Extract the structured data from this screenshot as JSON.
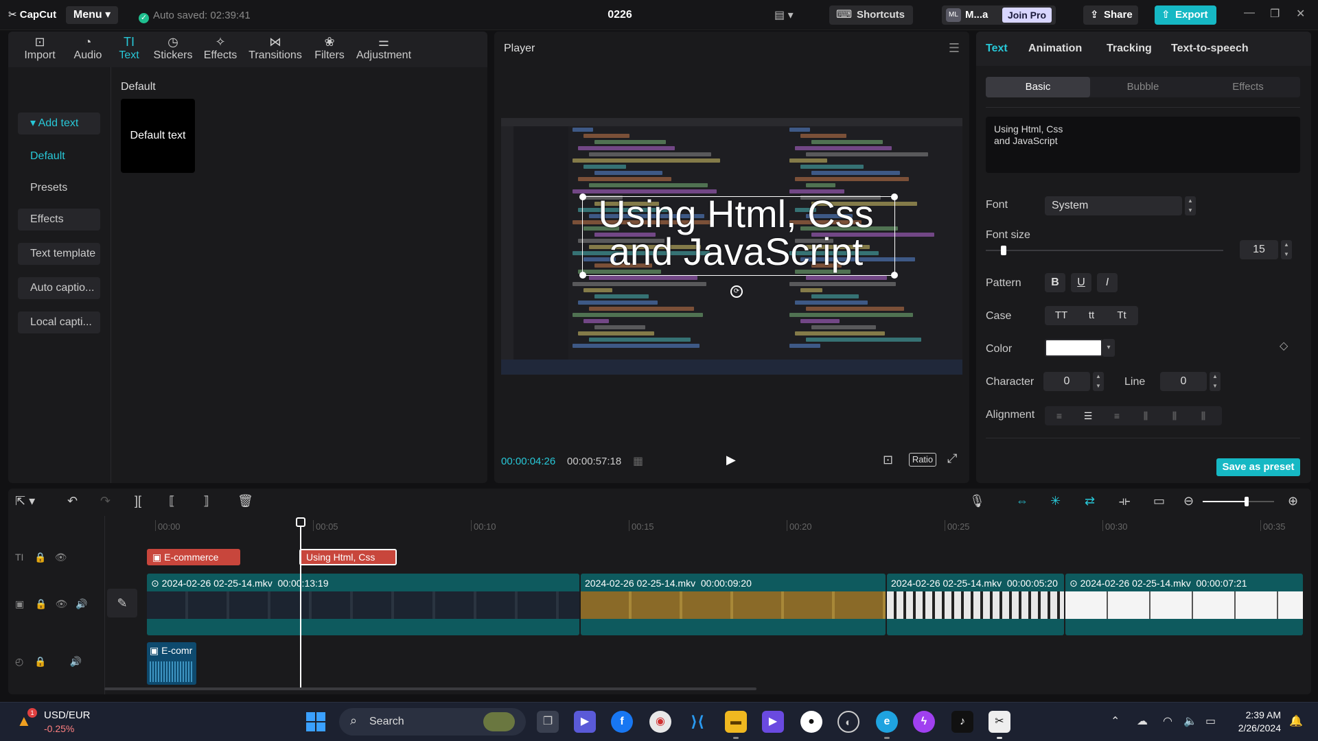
{
  "titlebar": {
    "logo": "CapCut",
    "menu_label": "Menu",
    "autosave": "Auto saved: 02:39:41",
    "project_title": "0226",
    "shortcuts_label": "Shortcuts",
    "avatar_initials": "ML",
    "username": "M...a",
    "join_pro_label": "Join Pro",
    "share_label": "Share",
    "export_label": "Export"
  },
  "toolbar": {
    "tabs": [
      {
        "label": "Import",
        "icon": "import-icon"
      },
      {
        "label": "Audio",
        "icon": "audio-icon"
      },
      {
        "label": "Text",
        "icon": "text-icon",
        "active": true
      },
      {
        "label": "Stickers",
        "icon": "stickers-icon"
      },
      {
        "label": "Effects",
        "icon": "effects-icon"
      },
      {
        "label": "Transitions",
        "icon": "transitions-icon"
      },
      {
        "label": "Filters",
        "icon": "filters-icon"
      },
      {
        "label": "Adjustment",
        "icon": "adjustment-icon"
      }
    ]
  },
  "text_panel": {
    "nav": [
      "Add text",
      "Default",
      "Presets",
      "Effects",
      "Text template",
      "Auto captio...",
      "Local capti..."
    ],
    "section_title": "Default",
    "card_label": "Default text"
  },
  "player": {
    "title": "Player",
    "overlay_line1": "Using Html, Css",
    "overlay_line2": "and JavaScript",
    "current_time": "00:00:04:26",
    "total_time": "00:00:57:18",
    "ratio_label": "Ratio"
  },
  "properties": {
    "tabs": [
      "Text",
      "Animation",
      "Tracking",
      "Text-to-speech"
    ],
    "segments": [
      "Basic",
      "Bubble",
      "Effects"
    ],
    "text_value": "Using Html, Css\nand JavaScript",
    "font_label": "Font",
    "font_value": "System",
    "font_size_label": "Font size",
    "font_size_value": "15",
    "font_size_fraction": 0.04,
    "pattern_label": "Pattern",
    "pattern_buttons": [
      "B",
      "U",
      "I"
    ],
    "case_label": "Case",
    "case_buttons": [
      "TT",
      "tt",
      "Tt"
    ],
    "color_label": "Color",
    "color_value": "#ffffff",
    "character_label": "Character",
    "character_value": "0",
    "line_label": "Line",
    "line_value": "0",
    "alignment_label": "Alignment",
    "save_preset_label": "Save as preset"
  },
  "timeline": {
    "ruler": [
      "00:00",
      "00:05",
      "00:10",
      "00:15",
      "00:20",
      "00:25",
      "00:30",
      "00:35"
    ],
    "text_clips": [
      "E-commerce",
      "Using Html, Css"
    ],
    "video_clips": [
      {
        "label": "2024-02-26 02-25-14.mkv",
        "duration": "00:00:13:19"
      },
      {
        "label": "2024-02-26 02-25-14.mkv",
        "duration": "00:00:09:20"
      },
      {
        "label": "2024-02-26 02-25-14.mkv",
        "duration": "00:00:05:20"
      },
      {
        "label": "2024-02-26 02-25-14.mkv",
        "duration": "00:00:07:21"
      }
    ],
    "audio_clip": "E-comr",
    "zoom_level": 0.62
  },
  "taskbar": {
    "ticker_label": "USD/EUR",
    "ticker_change": "-0.25%",
    "ticker_badge": "1",
    "search_label": "Search",
    "time": "2:39 AM",
    "date": "2/26/2024"
  },
  "colors": {
    "accent": "#28c8d8",
    "export": "#16b8c4",
    "text_clip": "#c8463c",
    "video_clip": "#0e5a5e"
  }
}
